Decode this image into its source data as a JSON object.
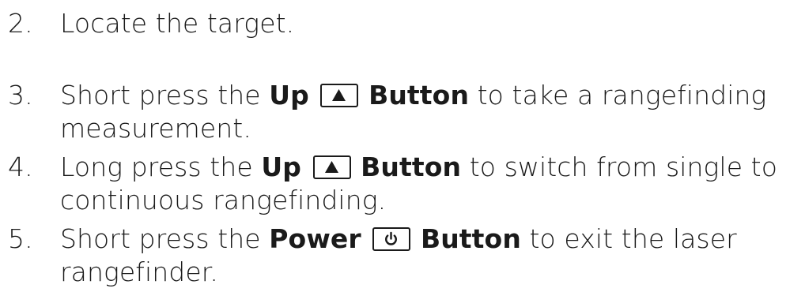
{
  "steps": [
    {
      "number": "2.",
      "text": "Locate the target."
    },
    {
      "number": "3.",
      "pre": "Short press the ",
      "button_name": "Up",
      "button_label": "Button",
      "icon": "up-triangle-icon",
      "post": " to take a rangefinding measurement."
    },
    {
      "number": "4.",
      "pre": "Long press the ",
      "button_name": "Up",
      "button_label": "Button",
      "icon": "up-triangle-icon",
      "post": " to switch from single to continuous rangefinding."
    },
    {
      "number": "5.",
      "pre": "Short press the ",
      "button_name": "Power",
      "button_label": "Button",
      "icon": "power-icon",
      "post": " to exit the laser rangefinder."
    }
  ]
}
